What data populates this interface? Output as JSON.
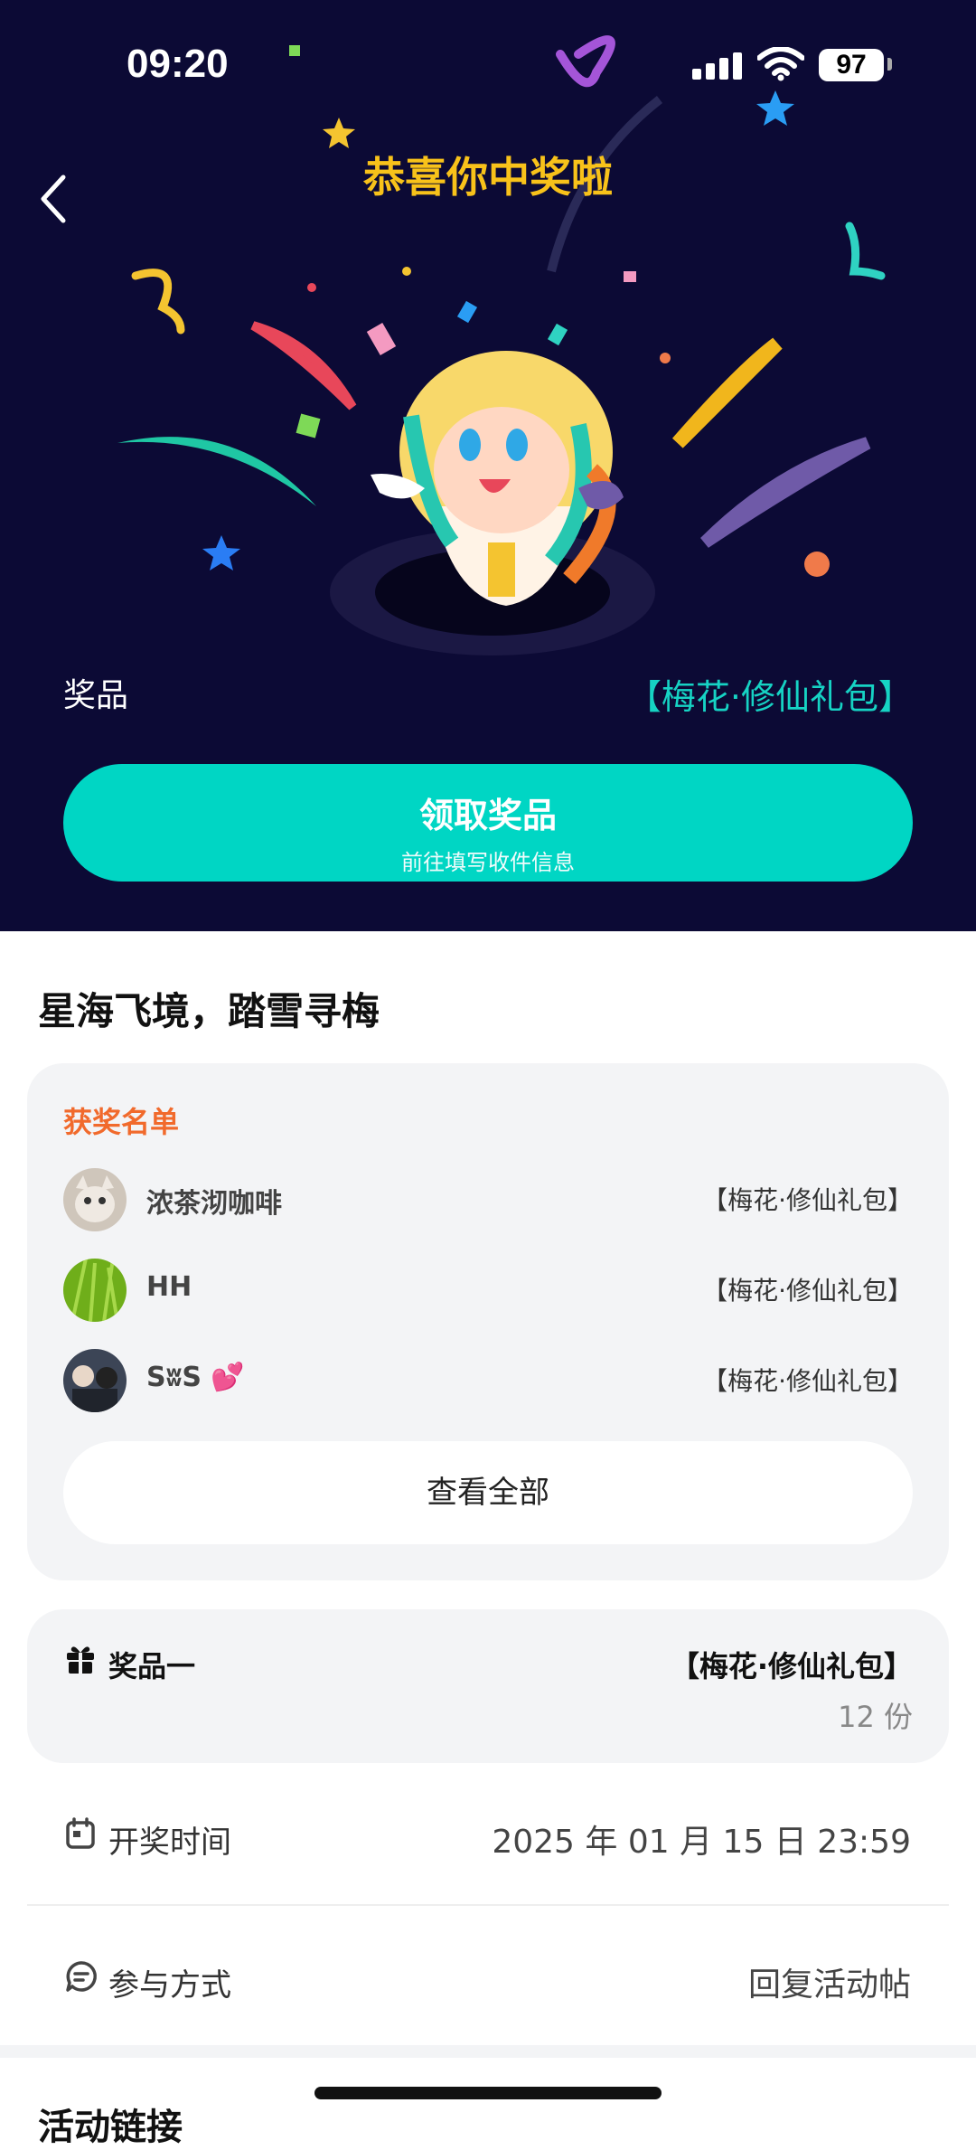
{
  "status_bar": {
    "time": "09:20",
    "battery": "97"
  },
  "hero": {
    "title": "恭喜你中奖啦",
    "prize_label": "奖品",
    "prize_value": "【梅花·修仙礼包】",
    "claim_button": {
      "label": "领取奖品",
      "sublabel": "前往填写收件信息"
    }
  },
  "activity_title": "星海飞境，踏雪寻梅",
  "winners": {
    "title": "获奖名单",
    "items": [
      {
        "name": "浓茶沏咖啡",
        "prize": "【梅花·修仙礼包】"
      },
      {
        "name": "HH",
        "prize": "【梅花·修仙礼包】"
      },
      {
        "name": "SʬS 💕",
        "prize": "【梅花·修仙礼包】"
      }
    ],
    "view_all": "查看全部"
  },
  "prize_one": {
    "label": "奖品一",
    "value": "【梅花·修仙礼包】",
    "count": "12 份"
  },
  "draw_time": {
    "label": "开奖时间",
    "value": "2025 年 01 月 15 日 23:59"
  },
  "participation": {
    "label": "参与方式",
    "value": "回复活动帖"
  },
  "next_section_title": "活动链接",
  "colors": {
    "hero_bg": "#0c0a35",
    "accent": "#00d6c4",
    "title_gold": "#f8c21a",
    "winners_orange": "#f16a2c"
  },
  "icons": [
    "back-icon",
    "gift-icon",
    "calendar-icon",
    "chat-icon",
    "signal-icon",
    "wifi-icon",
    "battery-icon"
  ]
}
